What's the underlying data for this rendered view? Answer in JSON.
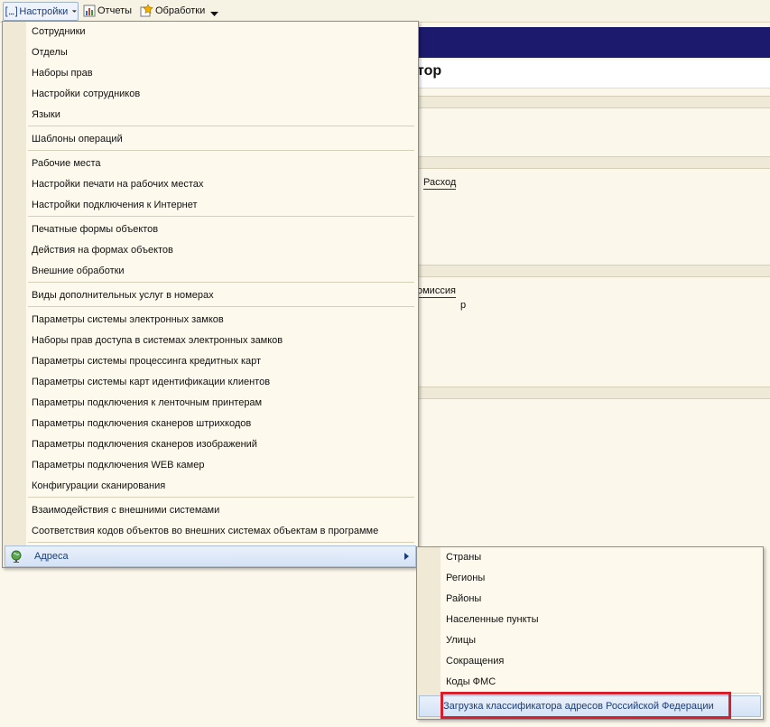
{
  "menubar": {
    "settings": "Настройки",
    "reports": "Отчеты",
    "processing": "Обработки"
  },
  "background": {
    "title_fragment": "тор",
    "expense_label": "Расход",
    "commission_label": "омиссия",
    "currency_label": "р"
  },
  "settings_menu": {
    "items": [
      "Сотрудники",
      "Отделы",
      "Наборы прав",
      "Настройки сотрудников",
      "Языки",
      "Шаблоны операций",
      "Рабочие места",
      "Настройки печати на рабочих местах",
      "Настройки подключения к Интернет",
      "Печатные формы объектов",
      "Действия на формах объектов",
      "Внешние обработки",
      "Виды дополнительных услуг в номерах",
      "Параметры системы электронных замков",
      "Наборы прав доступа в системах электронных замков",
      "Параметры системы процессинга кредитных карт",
      "Параметры системы карт идентификации клиентов",
      "Параметры подключения к ленточным принтерам",
      "Параметры подключения сканеров штрихкодов",
      "Параметры подключения сканеров изображений",
      "Параметры подключения WEB камер",
      "Конфигурации сканирования",
      "Взаимодействия с внешними системами",
      "Соответствия кодов объектов во внешних системах объектам в программе"
    ],
    "addresses": "Адреса"
  },
  "addresses_submenu": {
    "items": [
      "Страны",
      "Регионы",
      "Районы",
      "Населенные пункты",
      "Улицы",
      "Сокращения",
      "Коды ФМС"
    ],
    "load_classifier": "Загрузка классификатора адресов Российской Федерации"
  },
  "colors": {
    "highlight_border": "#d8202c",
    "header_band": "#1b1a6c"
  }
}
